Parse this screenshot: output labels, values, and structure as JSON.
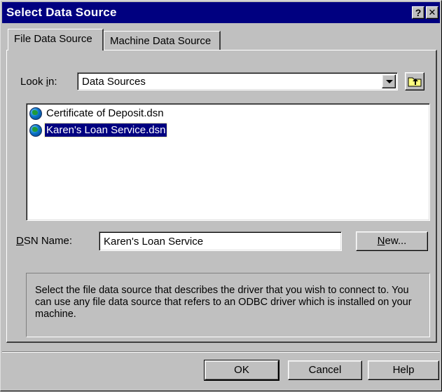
{
  "window": {
    "title": "Select Data Source",
    "help_glyph": "?",
    "close_glyph": "✕"
  },
  "tabs": [
    {
      "label": "File Data Source",
      "active": true
    },
    {
      "label": "Machine Data Source",
      "active": false
    }
  ],
  "look_in": {
    "label_pre": "Look ",
    "label_hot": "i",
    "label_post": "n:",
    "value": "Data Sources"
  },
  "files": [
    {
      "name": "Certificate of Deposit.dsn",
      "icon": "dsn-globe-icon",
      "selected": false
    },
    {
      "name": "Karen's Loan Service.dsn",
      "icon": "dsn-globe-icon",
      "selected": true
    }
  ],
  "dsn": {
    "label_hot": "D",
    "label_post": "SN Name:",
    "value": "Karen's Loan Service"
  },
  "buttons": {
    "new_hot": "N",
    "new_post": "ew...",
    "ok": "OK",
    "cancel": "Cancel",
    "help": "Help"
  },
  "description": "Select the file data source that describes the driver that you wish to connect to. You can use any file data source that refers to an ODBC driver which is installed on your machine.",
  "colors": {
    "titlebar": "#000080",
    "face": "#c0c0c0",
    "selection": "#000080"
  }
}
